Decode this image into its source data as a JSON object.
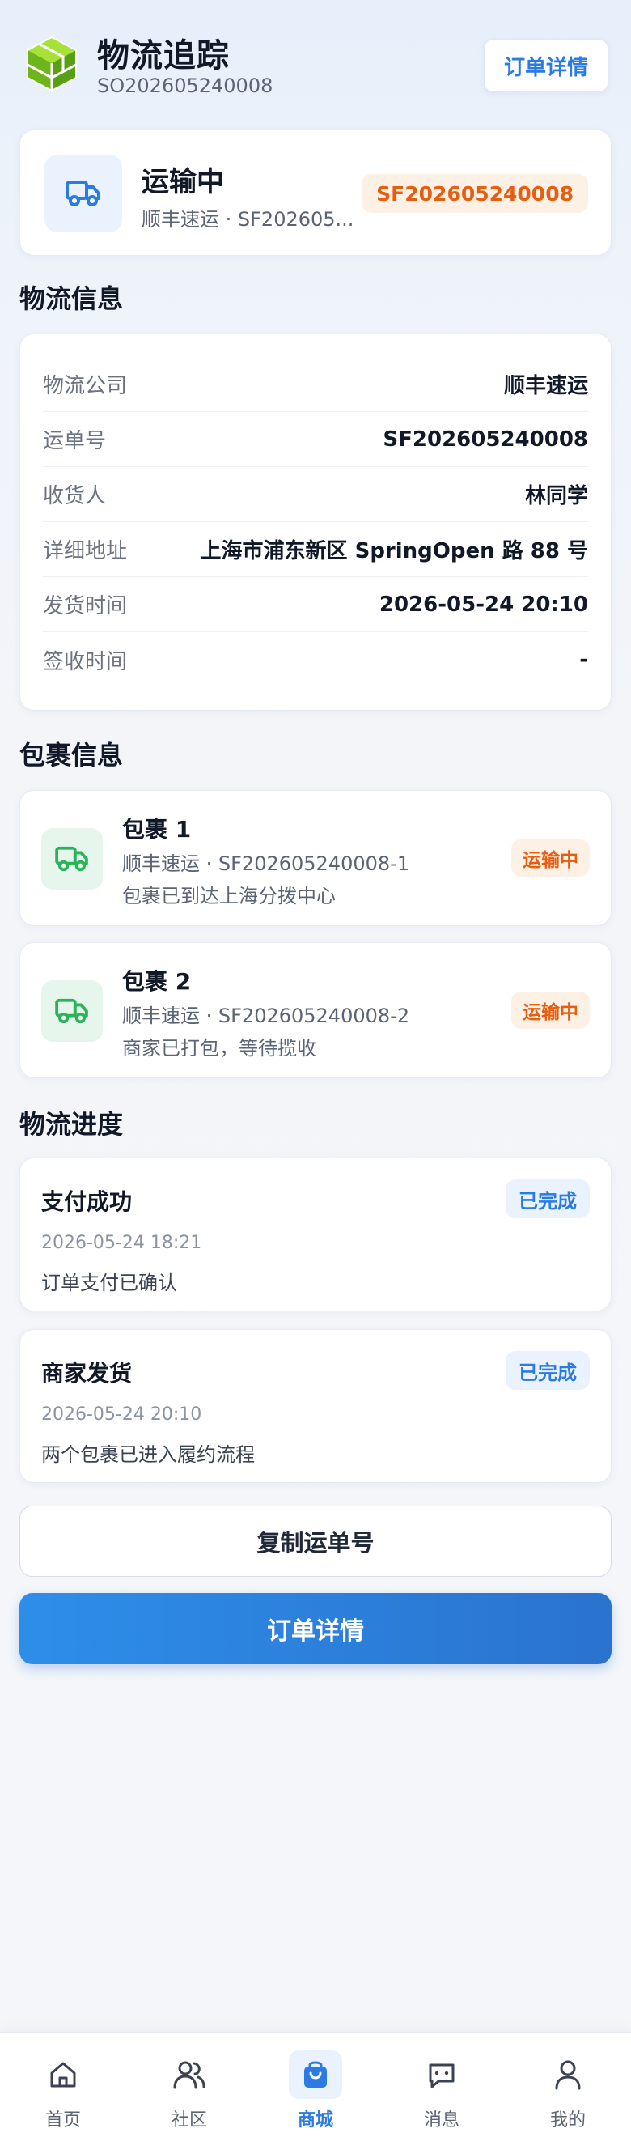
{
  "header": {
    "title": "物流追踪",
    "order_no": "SO202605240008",
    "order_detail_button": "订单详情"
  },
  "status_card": {
    "status": "运输中",
    "carrier_line": "顺丰速运 · SF202605...",
    "tracking_badge": "SF202605240008"
  },
  "logistics_info": {
    "section_title": "物流信息",
    "rows": [
      {
        "label": "物流公司",
        "value": "顺丰速运"
      },
      {
        "label": "运单号",
        "value": "SF202605240008"
      },
      {
        "label": "收货人",
        "value": "林同学"
      },
      {
        "label": "详细地址",
        "value": "上海市浦东新区 SpringOpen 路 88 号"
      },
      {
        "label": "发货时间",
        "value": "2026-05-24 20:10"
      },
      {
        "label": "签收时间",
        "value": "-"
      }
    ]
  },
  "packages": {
    "section_title": "包裹信息",
    "items": [
      {
        "title": "包裹 1",
        "sub": "顺丰速运 · SF202605240008-1",
        "note": "包裹已到达上海分拨中心",
        "status": "运输中"
      },
      {
        "title": "包裹 2",
        "sub": "顺丰速运 · SF202605240008-2",
        "note": "商家已打包，等待揽收",
        "status": "运输中"
      }
    ]
  },
  "progress": {
    "section_title": "物流进度",
    "items": [
      {
        "title": "支付成功",
        "time": "2026-05-24 18:21",
        "note": "订单支付已确认",
        "status": "已完成"
      },
      {
        "title": "商家发货",
        "time": "2026-05-24 20:10",
        "note": "两个包裹已进入履约流程",
        "status": "已完成"
      }
    ]
  },
  "actions": {
    "copy_label": "复制运单号",
    "detail_label": "订单详情"
  },
  "tabbar": {
    "items": [
      {
        "label": "首页",
        "icon": "home-icon"
      },
      {
        "label": "社区",
        "icon": "community-icon"
      },
      {
        "label": "商城",
        "icon": "shopping-bag-icon",
        "active": true
      },
      {
        "label": "消息",
        "icon": "message-icon"
      },
      {
        "label": "我的",
        "icon": "profile-icon"
      }
    ]
  },
  "colors": {
    "accent_blue": "#2a7be4",
    "orange": "#e65f10",
    "green": "#2bb35a",
    "logo_green": "#7cc41c"
  }
}
